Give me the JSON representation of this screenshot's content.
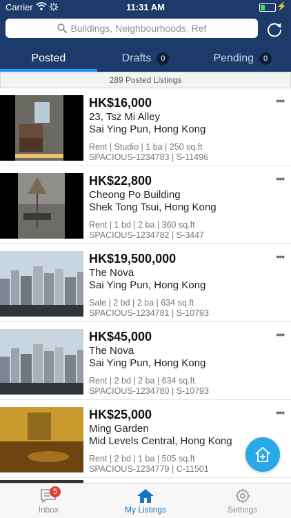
{
  "status_bar": {
    "carrier": "Carrier",
    "time": "11:31 AM"
  },
  "search": {
    "placeholder": "Buildings, Neighbourhoods, Ref"
  },
  "tabs": [
    {
      "label": "Posted",
      "active": true
    },
    {
      "label": "Drafts",
      "count": "0"
    },
    {
      "label": "Pending",
      "count": "0"
    }
  ],
  "summary": "289 Posted Listings",
  "listings": [
    {
      "price": "HK$16,000",
      "building": "23, Tsz Mi Alley",
      "area": "Sai Ying Pun, Hong Kong",
      "details": "Rent | Studio | 1 ba | 250 sq.ft",
      "refs": "SPACIOUS-1234783 | S-11496"
    },
    {
      "price": "HK$22,800",
      "building": "Cheong Po Building",
      "area": "Shek Tong Tsui, Hong Kong",
      "details": "Rent | 1 bd | 2 ba | 360 sq.ft",
      "refs": "SPACIOUS-1234782 | S-3447"
    },
    {
      "price": "HK$19,500,000",
      "building": "The Nova",
      "area": "Sai Ying Pun, Hong Kong",
      "details": "Sale | 2 bd | 2 ba | 634 sq.ft",
      "refs": "SPACIOUS-1234781 | S-10793"
    },
    {
      "price": "HK$45,000",
      "building": "The Nova",
      "area": "Sai Ying Pun, Hong Kong",
      "details": "Rent | 2 bd | 2 ba | 634 sq.ft",
      "refs": "SPACIOUS-1234780 | S-10793"
    },
    {
      "price": "HK$25,000",
      "building": "Ming Garden",
      "area": "Mid Levels Central, Hong Kong",
      "details": "Rent | 2 bd | 1 ba | 505 sq.ft",
      "refs": "SPACIOUS-1234779 | C-11501"
    }
  ],
  "more_glyph": "•••",
  "bottom_nav": {
    "inbox": {
      "label": "Inbox",
      "badge": "5"
    },
    "my_listings": {
      "label": "My Listings",
      "active": true
    },
    "settings": {
      "label": "Settings"
    }
  },
  "colors": {
    "header": "#1c3b6a",
    "accent": "#2196f3",
    "fab": "#29a8e8",
    "active_nav": "#1e73be",
    "badge": "#e53935"
  }
}
